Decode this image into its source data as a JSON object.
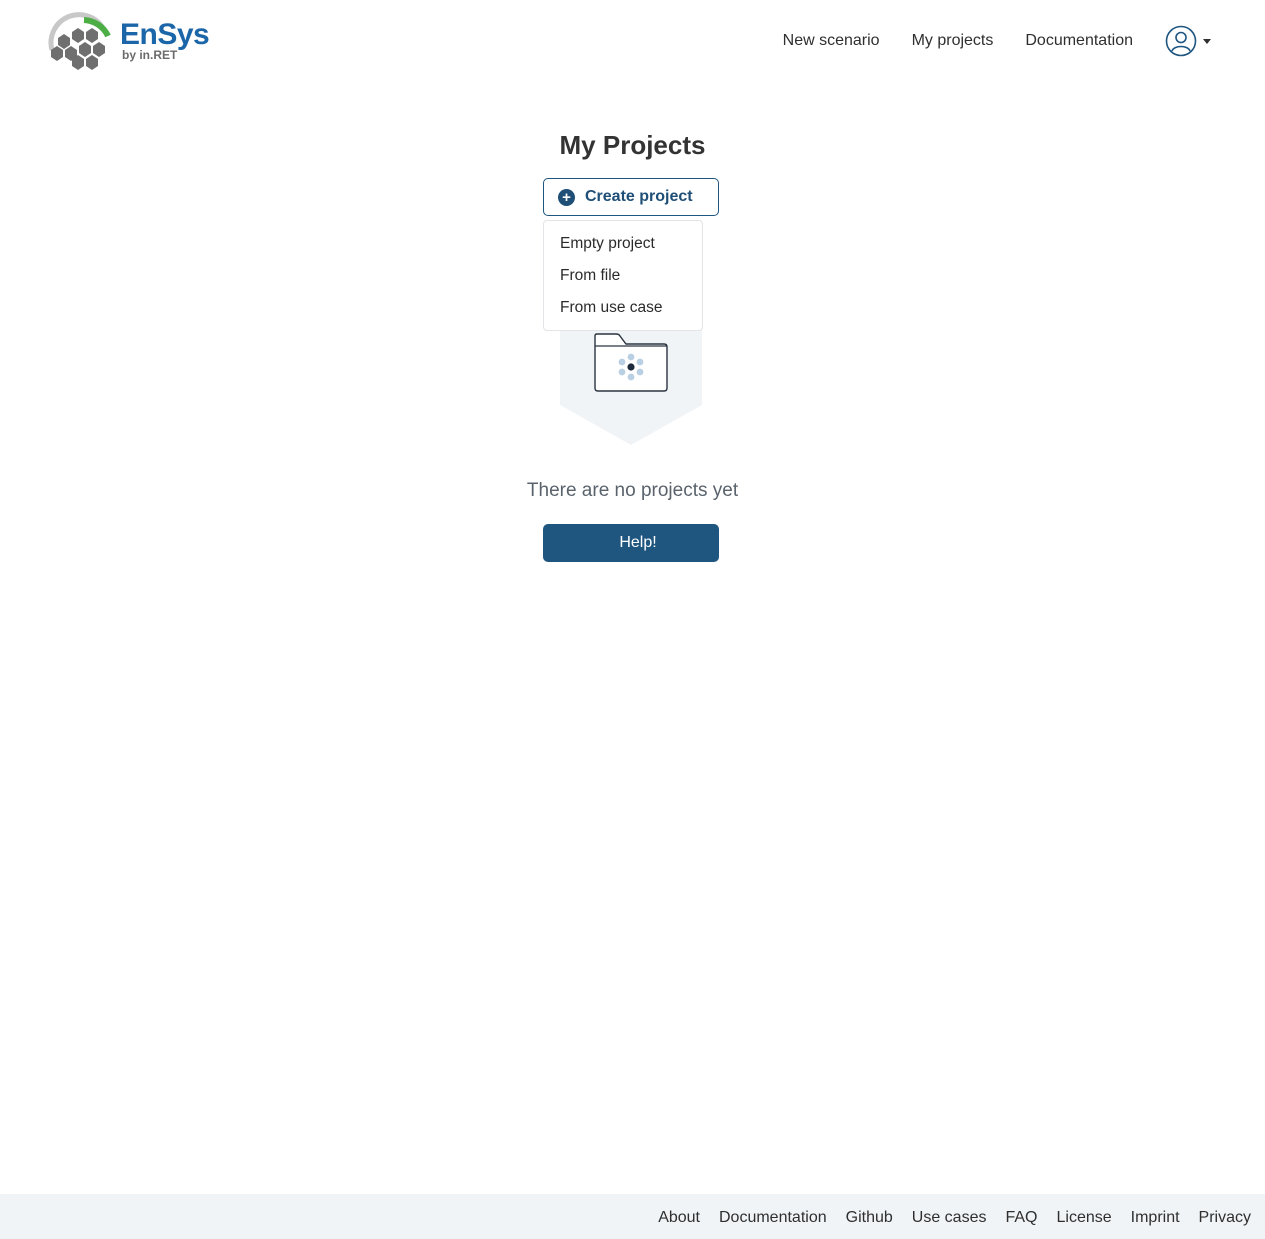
{
  "brand": {
    "title": "EnSys",
    "subtitle": "by in.RET",
    "colors": {
      "primary": "#1f5680",
      "logo_blue": "#1b66a8",
      "logo_green": "#4cae45",
      "logo_gray": "#6b6b6b"
    }
  },
  "nav": {
    "items": [
      {
        "label": "New scenario"
      },
      {
        "label": "My projects"
      },
      {
        "label": "Documentation"
      }
    ],
    "user_icon": "user-circle-icon"
  },
  "main": {
    "title": "My Projects",
    "create_button": {
      "label": "Create project",
      "icon": "plus-circle-icon"
    },
    "create_menu": {
      "items": [
        {
          "label": "Empty project"
        },
        {
          "label": "From file"
        },
        {
          "label": "From use case"
        }
      ]
    },
    "empty_state": {
      "icon": "folder-icon",
      "message": "There are no projects yet"
    },
    "help_button": {
      "label": "Help!"
    }
  },
  "footer": {
    "links": [
      {
        "label": "About"
      },
      {
        "label": "Documentation"
      },
      {
        "label": "Github"
      },
      {
        "label": "Use cases"
      },
      {
        "label": "FAQ"
      },
      {
        "label": "License"
      },
      {
        "label": "Imprint"
      },
      {
        "label": "Privacy"
      }
    ]
  }
}
